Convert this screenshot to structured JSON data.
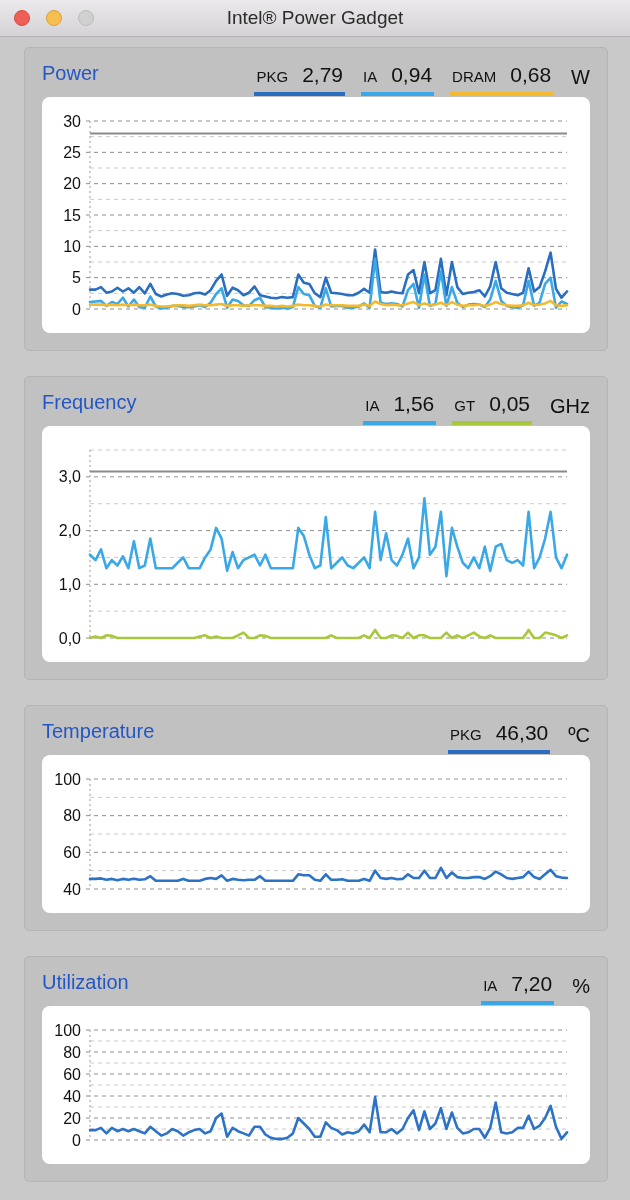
{
  "window": {
    "controls": [
      {
        "kind": "close",
        "disabled": false
      },
      {
        "kind": "minimize",
        "disabled": false
      },
      {
        "kind": "zoom",
        "disabled": true
      }
    ],
    "title": "Intel® Power Gadget"
  },
  "panels": [
    {
      "title": "Power",
      "readings": [
        {
          "value": "2,79",
          "color": "#2a6ebf"
        },
        {
          "value": "0,94",
          "color": "#3aa8e6"
        },
        {
          "value": "0,68",
          "color": "#f4b92d"
        }
      ],
      "unit": "W",
      "chart_data": {
        "type": "line",
        "ylim": [
          0,
          30
        ],
        "yticks": [
          0,
          5,
          10,
          15,
          20,
          25,
          30
        ],
        "grid": true,
        "ref_lines": [
          {
            "axis": "y",
            "value": 28
          }
        ],
        "series": [
          {
            "name": "PKG",
            "color": "#2a6ebf",
            "values": [
              3.1,
              3.1,
              3.5,
              2.6,
              2.8,
              3.4,
              2.8,
              3.3,
              2.6,
              3.5,
              2.5,
              4.0,
              2.4,
              2.0,
              2.3,
              2.5,
              2.4,
              2.1,
              2.2,
              2.5,
              2.6,
              2.3,
              3.0,
              4.5,
              5.5,
              2.1,
              3.4,
              3.0,
              2.2,
              2.6,
              3.6,
              2.2,
              2.0,
              1.8,
              1.7,
              1.9,
              1.8,
              1.9,
              5.5,
              4.2,
              4.0,
              2.5,
              1.9,
              5.0,
              2.6,
              2.5,
              2.4,
              2.2,
              2.2,
              2.6,
              3.2,
              2.6,
              9.5,
              2.7,
              2.6,
              2.8,
              2.6,
              2.5,
              5.5,
              6.2,
              2.5,
              7.5,
              2.5,
              3.0,
              8.0,
              2.2,
              7.5,
              3.5,
              2.4,
              2.6,
              2.7,
              3.0,
              2.0,
              3.6,
              7.5,
              3.3,
              2.6,
              2.4,
              2.2,
              2.6,
              6.5,
              2.8,
              3.5,
              6.0,
              9.0,
              3.2,
              1.8,
              2.8
            ]
          },
          {
            "name": "IA",
            "color": "#3aa8e6",
            "values": [
              1.1,
              1.2,
              1.3,
              0.5,
              1.1,
              0.8,
              1.8,
              0.4,
              1.5,
              0.3,
              0.2,
              2.0,
              0.4,
              0.1,
              0.2,
              0.5,
              0.5,
              0.3,
              0.3,
              0.4,
              0.6,
              0.3,
              1.0,
              2.4,
              3.3,
              0.2,
              1.5,
              1.3,
              0.6,
              0.5,
              1.4,
              1.8,
              0.3,
              0.2,
              0.1,
              0.2,
              0.1,
              0.3,
              3.5,
              2.4,
              2.2,
              0.5,
              0.2,
              3.3,
              0.4,
              0.5,
              0.5,
              0.2,
              0.2,
              0.4,
              0.9,
              0.2,
              8.0,
              1.0,
              0.8,
              0.9,
              0.8,
              0.4,
              3.0,
              4.0,
              0.2,
              5.5,
              0.5,
              0.8,
              6.0,
              0.5,
              3.5,
              1.0,
              0.3,
              0.7,
              0.8,
              0.7,
              0.3,
              1.5,
              4.5,
              1.3,
              0.5,
              0.3,
              0.2,
              0.6,
              4.5,
              0.5,
              1.0,
              4.0,
              5.0,
              0.2,
              1.2,
              0.8
            ]
          },
          {
            "name": "DRAM",
            "color": "#f4b92d",
            "values": [
              0.7,
              0.7,
              0.7,
              0.6,
              0.7,
              0.6,
              0.7,
              0.6,
              0.7,
              0.6,
              0.6,
              0.7,
              0.5,
              0.4,
              0.4,
              0.5,
              0.6,
              0.6,
              0.5,
              0.6,
              0.7,
              0.6,
              0.6,
              0.7,
              0.8,
              0.5,
              0.6,
              0.6,
              0.5,
              0.6,
              0.6,
              0.6,
              0.5,
              0.5,
              0.4,
              0.5,
              0.4,
              0.5,
              0.7,
              0.6,
              0.6,
              0.5,
              0.4,
              0.7,
              0.6,
              0.6,
              0.6,
              0.5,
              0.5,
              0.5,
              0.7,
              0.5,
              1.2,
              0.8,
              0.6,
              0.7,
              0.6,
              0.6,
              0.9,
              1.1,
              0.6,
              0.9,
              0.6,
              0.7,
              1.0,
              0.6,
              1.1,
              0.7,
              0.5,
              0.6,
              0.6,
              0.7,
              0.5,
              0.7,
              1.1,
              0.8,
              0.6,
              0.5,
              0.5,
              0.6,
              1.0,
              0.6,
              0.7,
              0.9,
              1.3,
              0.6,
              0.5,
              0.6
            ]
          }
        ]
      }
    },
    {
      "title": "Frequency",
      "readings": [
        {
          "value": "1,56",
          "color": "#3aa8e6"
        },
        {
          "value": "0,05",
          "color": "#a8c83c"
        }
      ],
      "unit": "GHz",
      "chart_data": {
        "type": "line",
        "ylim": [
          0,
          3.5
        ],
        "yticks": [
          {
            "value": 0,
            "label": "0,0"
          },
          {
            "value": 1,
            "label": "1,0"
          },
          {
            "value": 2,
            "label": "2,0"
          },
          {
            "value": 3,
            "label": "3,0"
          }
        ],
        "grid": true,
        "ref_lines": [
          {
            "axis": "y",
            "value": 3.1
          }
        ],
        "series": [
          {
            "name": "IA",
            "color": "#3aa8e6",
            "values": [
              1.55,
              1.45,
              1.65,
              1.3,
              1.45,
              1.35,
              1.52,
              1.3,
              1.8,
              1.3,
              1.35,
              1.85,
              1.3,
              1.3,
              1.3,
              1.3,
              1.4,
              1.5,
              1.3,
              1.3,
              1.3,
              1.5,
              1.65,
              2.05,
              1.85,
              1.25,
              1.6,
              1.3,
              1.45,
              1.5,
              1.55,
              1.35,
              1.55,
              1.3,
              1.3,
              1.3,
              1.3,
              1.3,
              2.05,
              1.9,
              1.55,
              1.3,
              1.35,
              2.25,
              1.3,
              1.4,
              1.5,
              1.35,
              1.3,
              1.4,
              1.5,
              1.3,
              2.35,
              1.45,
              1.95,
              1.45,
              1.35,
              1.55,
              1.85,
              1.3,
              1.5,
              2.6,
              1.55,
              1.7,
              2.35,
              1.15,
              2.05,
              1.7,
              1.4,
              1.3,
              1.5,
              1.3,
              1.7,
              1.25,
              1.7,
              1.75,
              1.45,
              1.4,
              1.45,
              1.35,
              2.35,
              1.3,
              1.5,
              1.85,
              2.35,
              1.5,
              1.3,
              1.55
            ]
          },
          {
            "name": "GT",
            "color": "#a8c83c",
            "values": [
              0,
              0.03,
              0,
              0.05,
              0.04,
              0,
              0,
              0,
              0,
              0,
              0,
              0,
              0,
              0,
              0,
              0,
              0,
              0,
              0,
              0,
              0.03,
              0.05,
              0,
              0.03,
              0,
              0,
              0,
              0.05,
              0.1,
              0,
              0,
              0.05,
              0.04,
              0,
              0,
              0,
              0,
              0,
              0,
              0,
              0,
              0,
              0,
              0,
              0.05,
              0,
              0,
              0,
              0,
              0,
              0.05,
              0,
              0.15,
              0,
              0,
              0.05,
              0.04,
              0,
              0.1,
              0,
              0.05,
              0.05,
              0,
              0,
              0,
              0.1,
              0,
              0.05,
              0,
              0.05,
              0.1,
              0.03,
              0,
              0.05,
              0,
              0,
              0,
              0,
              0,
              0,
              0.15,
              0,
              0,
              0.1,
              0.08,
              0.05,
              0,
              0.05
            ]
          }
        ]
      }
    },
    {
      "title": "Temperature",
      "readings": [
        {
          "value": "46,30",
          "color": "#2a6ebf"
        }
      ],
      "unit": "ºC",
      "chart_data": {
        "type": "line",
        "ylim": [
          40,
          100
        ],
        "yticks": [
          40,
          60,
          80,
          100
        ],
        "grid": true,
        "series": [
          {
            "name": "PKG",
            "color": "#2c72c6",
            "values": [
              45.5,
              45.5,
              45.8,
              45,
              45.5,
              44.8,
              45.5,
              45,
              45.6,
              45,
              45.3,
              47,
              44.5,
              44.5,
              44.5,
              44.5,
              44.5,
              45.5,
              44.5,
              44.5,
              44.5,
              45.5,
              46,
              45.5,
              47.5,
              44.5,
              45.5,
              45,
              44.8,
              45,
              45,
              47,
              44.5,
              44.5,
              44.5,
              44.5,
              44.5,
              44.5,
              48,
              47.5,
              47.5,
              45,
              44.5,
              48,
              45,
              45,
              45.3,
              44.5,
              44.5,
              44.5,
              45.5,
              44.5,
              50,
              46,
              45.5,
              46,
              45.3,
              45.5,
              48,
              46,
              46,
              50,
              46,
              46,
              51.5,
              46,
              49,
              46.5,
              46,
              46,
              46.5,
              46.5,
              45.5,
              47,
              49.5,
              48,
              46,
              45.5,
              46,
              46.5,
              49.5,
              46.5,
              45.5,
              48,
              50.5,
              47,
              46.2,
              46
            ]
          }
        ]
      }
    },
    {
      "title": "Utilization",
      "readings": [
        {
          "value": "7,20",
          "color": "#3aa8e6"
        }
      ],
      "unit": "%",
      "chart_data": {
        "type": "line",
        "ylim": [
          0,
          100
        ],
        "yticks": [
          0,
          20,
          40,
          60,
          80,
          100
        ],
        "grid": true,
        "series": [
          {
            "name": "IA",
            "color": "#2c72c6",
            "values": [
              9,
              9,
              11,
              6,
              11,
              8,
              10,
              8,
              10,
              8,
              6,
              12,
              8,
              4,
              6,
              10,
              8,
              4,
              7,
              9,
              10,
              6,
              8,
              20,
              24,
              3,
              11,
              8,
              6,
              4,
              12,
              12,
              5,
              2,
              1,
              1,
              2,
              6,
              20,
              15,
              10,
              3,
              3,
              16,
              11,
              9,
              5,
              7,
              6,
              8,
              14,
              7,
              39,
              7,
              7,
              10,
              6,
              10,
              20,
              27,
              9,
              26,
              10,
              15,
              29,
              10,
              25,
              11,
              6,
              7,
              10,
              10,
              2,
              11,
              34,
              7,
              6,
              7,
              11,
              11,
              22,
              10,
              13,
              20,
              31,
              12,
              1,
              7
            ]
          }
        ]
      }
    }
  ]
}
